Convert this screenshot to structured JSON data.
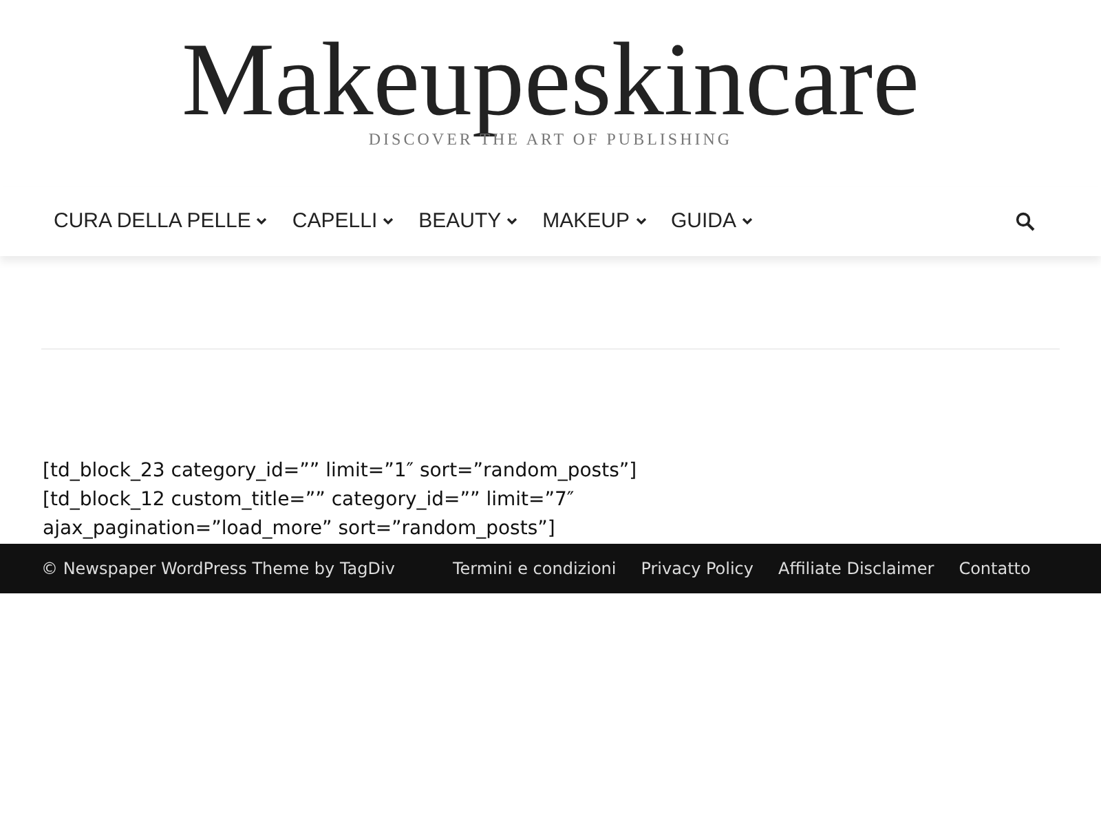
{
  "site": {
    "title": "Makeupeskincare",
    "tagline": "DISCOVER THE ART OF PUBLISHING"
  },
  "menu": [
    {
      "label": "CURA DELLA PELLE"
    },
    {
      "label": "CAPELLI"
    },
    {
      "label": "BEAUTY"
    },
    {
      "label": "MAKEUP"
    },
    {
      "label": "GUIDA"
    }
  ],
  "content": {
    "shortcodes": [
      "[td_block_23 category_id=”” limit=”1″ sort=”random_posts”]",
      "[td_block_12 custom_title=”” category_id=”” limit=”7″ ajax_pagination=”load_more” sort=”random_posts”]"
    ]
  },
  "footer": {
    "copyright": "© Newspaper WordPress Theme by TagDiv",
    "links": [
      "Termini e condizioni",
      "Privacy Policy",
      "Affiliate Disclaimer",
      "Contatto"
    ]
  }
}
